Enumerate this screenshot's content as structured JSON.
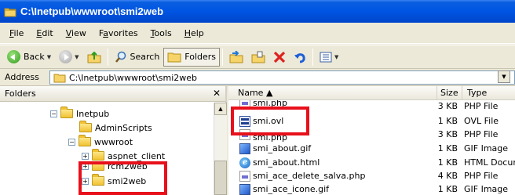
{
  "window": {
    "title": "C:\\Inetpub\\wwwroot\\smi2web"
  },
  "menu": [
    "File",
    "Edit",
    "View",
    "Favorites",
    "Tools",
    "Help"
  ],
  "menu_accelerators": [
    "F",
    "E",
    "V",
    "a",
    "T",
    "H"
  ],
  "toolbar": {
    "back_label": "Back",
    "search_label": "Search",
    "folders_label": "Folders"
  },
  "address": {
    "label": "Address",
    "value": "C:\\Inetpub\\wwwroot\\smi2web"
  },
  "folders_pane": {
    "title": "Folders",
    "tree": [
      {
        "label": "Inetpub",
        "expander": "−"
      },
      {
        "label": "AdminScripts",
        "expander": ""
      },
      {
        "label": "wwwroot",
        "expander": "−"
      },
      {
        "label": "aspnet_client",
        "expander": "+"
      },
      {
        "label": "rcm2web",
        "expander": "+"
      },
      {
        "label": "smi2web",
        "expander": "+"
      }
    ]
  },
  "files_pane": {
    "columns": {
      "name": "Name ▲",
      "size": "Size",
      "type": "Type"
    },
    "rows": [
      {
        "name": "smi.php",
        "size": "3 KB",
        "type": "PHP File",
        "icon": "php-file-icon"
      },
      {
        "name": "smi.ovl",
        "size": "1 KB",
        "type": "OVL File",
        "icon": "ovl-file-icon"
      },
      {
        "name": "smi.php",
        "size": "3 KB",
        "type": "PHP File",
        "icon": "php-file-icon"
      },
      {
        "name": "smi_about.gif",
        "size": "1 KB",
        "type": "GIF Image",
        "icon": "gif-image-icon"
      },
      {
        "name": "smi_about.html",
        "size": "1 KB",
        "type": "HTML Docum",
        "icon": "html-document-icon"
      },
      {
        "name": "smi_ace_delete_salva.php",
        "size": "4 KB",
        "type": "PHP File",
        "icon": "php-file-icon"
      },
      {
        "name": "smi_ace_icone.gif",
        "size": "1 KB",
        "type": "GIF Image",
        "icon": "gif-image-icon"
      }
    ]
  },
  "colors": {
    "highlight_box": "#e8101a",
    "titlebar": "#0054e3"
  }
}
